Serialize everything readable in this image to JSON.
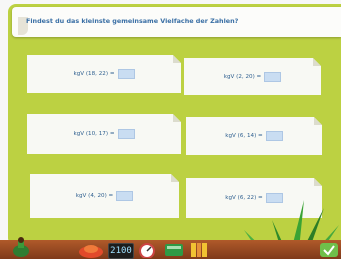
{
  "header": {
    "question": "Findest du das kleinste gemeinsame Vielfache der Zahlen?"
  },
  "cards": [
    {
      "label": "kgV (18, 22) =",
      "value": ""
    },
    {
      "label": "kgV (2, 20) =",
      "value": ""
    },
    {
      "label": "kgV (10, 17) =",
      "value": ""
    },
    {
      "label": "kgV (6, 14) =",
      "value": ""
    },
    {
      "label": "kgV (4, 20) =",
      "value": ""
    },
    {
      "label": "kgV (6, 22) =",
      "value": ""
    }
  ],
  "toolbar": {
    "clock_text": "2100"
  },
  "colors": {
    "board": "#bcd142",
    "accent": "#3a6fa5",
    "answer_box": "#c9ddf2"
  },
  "icons": [
    "potion-icon",
    "red-blob-icon",
    "clock-icon",
    "gauge-icon",
    "green-book-icon",
    "shelf-icon",
    "check-icon"
  ]
}
